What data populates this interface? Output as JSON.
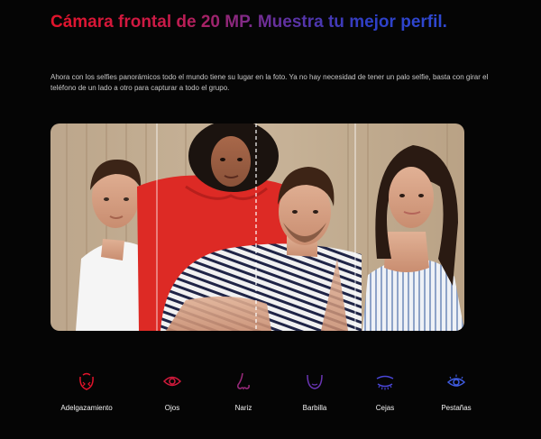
{
  "heading": {
    "title": "Cámara frontal de 20 MP. Muestra tu mejor perfil.",
    "description": "Ahora con los selfies panorámicos todo el mundo tiene su lugar en la foto. Ya no hay necesidad de tener un palo selfie, basta con girar el teléfono de un lado a otro para capturar a todo el grupo."
  },
  "features": [
    {
      "label": "Adelgazamiento",
      "icon": "face-slim-icon",
      "color": "#e3142b"
    },
    {
      "label": "Ojos",
      "icon": "eye-icon",
      "color": "#d21a3c"
    },
    {
      "label": "Nariz",
      "icon": "nose-icon",
      "color": "#9a2a7c"
    },
    {
      "label": "Barbilla",
      "icon": "chin-icon",
      "color": "#6a35b4"
    },
    {
      "label": "Cejas",
      "icon": "eyebrow-icon",
      "color": "#4a46d8"
    },
    {
      "label": "Pestañas",
      "icon": "eyelash-icon",
      "color": "#3f5be0"
    }
  ],
  "colors": {
    "background": "#050505",
    "accent_red": "#e3142b",
    "accent_blue": "#2f49d2"
  }
}
